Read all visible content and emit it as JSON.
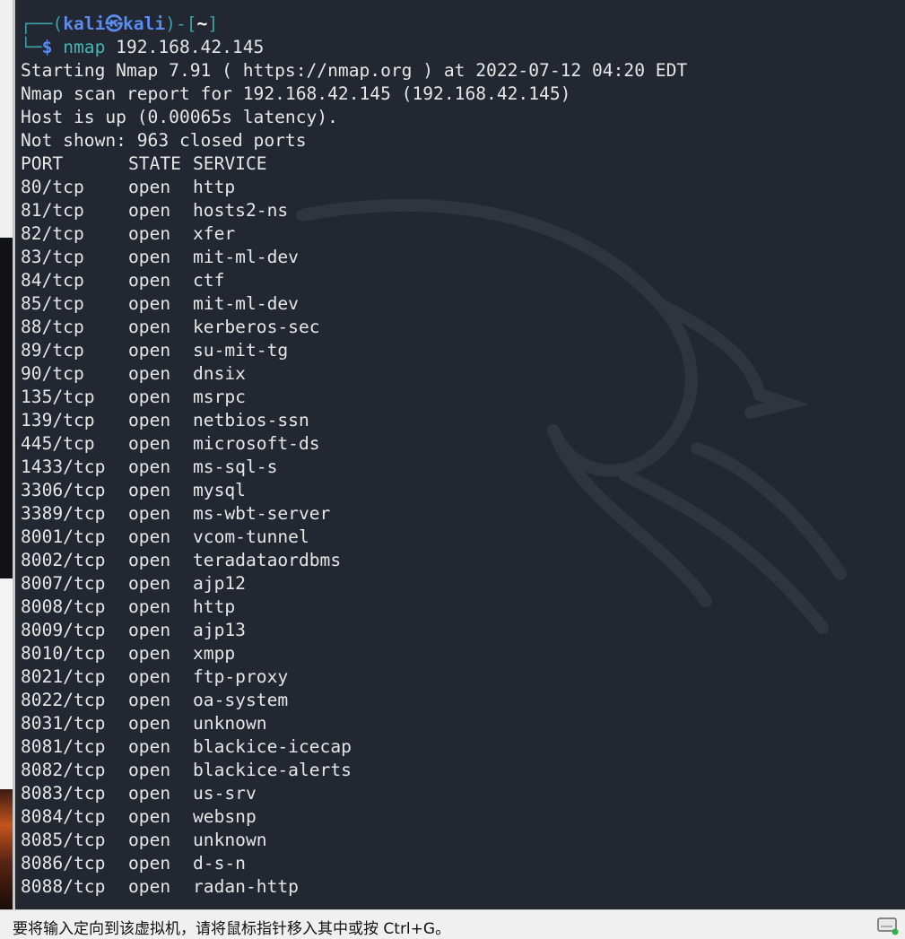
{
  "prompt": {
    "user": "kali",
    "at_glyph": "㉿",
    "host": "kali",
    "dir": "~",
    "command": "nmap",
    "argument": "192.168.42.145"
  },
  "output_lines": [
    "Starting Nmap 7.91 ( https://nmap.org ) at 2022-07-12 04:20 EDT",
    "Nmap scan report for 192.168.42.145 (192.168.42.145)",
    "Host is up (0.00065s latency).",
    "Not shown: 963 closed ports"
  ],
  "table_header": {
    "port": "PORT",
    "state": "STATE",
    "service": "SERVICE"
  },
  "ports": [
    {
      "port": "80/tcp",
      "state": "open",
      "service": "http"
    },
    {
      "port": "81/tcp",
      "state": "open",
      "service": "hosts2-ns"
    },
    {
      "port": "82/tcp",
      "state": "open",
      "service": "xfer"
    },
    {
      "port": "83/tcp",
      "state": "open",
      "service": "mit-ml-dev"
    },
    {
      "port": "84/tcp",
      "state": "open",
      "service": "ctf"
    },
    {
      "port": "85/tcp",
      "state": "open",
      "service": "mit-ml-dev"
    },
    {
      "port": "88/tcp",
      "state": "open",
      "service": "kerberos-sec"
    },
    {
      "port": "89/tcp",
      "state": "open",
      "service": "su-mit-tg"
    },
    {
      "port": "90/tcp",
      "state": "open",
      "service": "dnsix"
    },
    {
      "port": "135/tcp",
      "state": "open",
      "service": "msrpc"
    },
    {
      "port": "139/tcp",
      "state": "open",
      "service": "netbios-ssn"
    },
    {
      "port": "445/tcp",
      "state": "open",
      "service": "microsoft-ds"
    },
    {
      "port": "1433/tcp",
      "state": "open",
      "service": "ms-sql-s"
    },
    {
      "port": "3306/tcp",
      "state": "open",
      "service": "mysql"
    },
    {
      "port": "3389/tcp",
      "state": "open",
      "service": "ms-wbt-server"
    },
    {
      "port": "8001/tcp",
      "state": "open",
      "service": "vcom-tunnel"
    },
    {
      "port": "8002/tcp",
      "state": "open",
      "service": "teradataordbms"
    },
    {
      "port": "8007/tcp",
      "state": "open",
      "service": "ajp12"
    },
    {
      "port": "8008/tcp",
      "state": "open",
      "service": "http"
    },
    {
      "port": "8009/tcp",
      "state": "open",
      "service": "ajp13"
    },
    {
      "port": "8010/tcp",
      "state": "open",
      "service": "xmpp"
    },
    {
      "port": "8021/tcp",
      "state": "open",
      "service": "ftp-proxy"
    },
    {
      "port": "8022/tcp",
      "state": "open",
      "service": "oa-system"
    },
    {
      "port": "8031/tcp",
      "state": "open",
      "service": "unknown"
    },
    {
      "port": "8081/tcp",
      "state": "open",
      "service": "blackice-icecap"
    },
    {
      "port": "8082/tcp",
      "state": "open",
      "service": "blackice-alerts"
    },
    {
      "port": "8083/tcp",
      "state": "open",
      "service": "us-srv"
    },
    {
      "port": "8084/tcp",
      "state": "open",
      "service": "websnp"
    },
    {
      "port": "8085/tcp",
      "state": "open",
      "service": "unknown"
    },
    {
      "port": "8086/tcp",
      "state": "open",
      "service": "d-s-n"
    },
    {
      "port": "8088/tcp",
      "state": "open",
      "service": "radan-http"
    }
  ],
  "statusbar": {
    "message": "要将输入定向到该虚拟机，请将鼠标指针移入其中或按 Ctrl+G。",
    "icons": [
      "hard-drive-icon"
    ]
  },
  "colors": {
    "terminal_bg": "#222731",
    "prompt_bracket": "#3aa3a8",
    "prompt_userhost": "#5a8cf0",
    "command": "#40b8b6",
    "text": "#e6e6e6"
  }
}
